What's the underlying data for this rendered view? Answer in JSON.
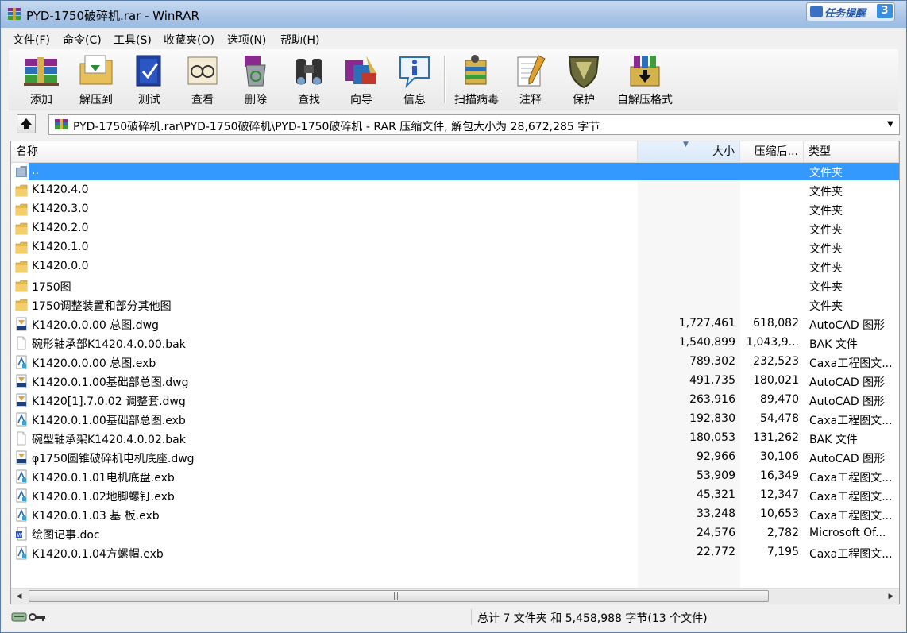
{
  "window": {
    "title": "PYD-1750破碎机.rar - WinRAR",
    "task_widget": {
      "label": "任务提醒",
      "count": "3"
    }
  },
  "menu": [
    "文件(F)",
    "命令(C)",
    "工具(S)",
    "收藏夹(O)",
    "选项(N)",
    "帮助(H)"
  ],
  "toolbar": [
    {
      "label": "添加",
      "icon": "add-books-icon"
    },
    {
      "label": "解压到",
      "icon": "extract-folder-icon"
    },
    {
      "label": "测试",
      "icon": "test-book-icon"
    },
    {
      "label": "查看",
      "icon": "view-glasses-icon"
    },
    {
      "label": "删除",
      "icon": "delete-recycle-icon"
    },
    {
      "label": "查找",
      "icon": "find-binoculars-icon"
    },
    {
      "label": "向导",
      "icon": "wizard-icon"
    },
    {
      "label": "信息",
      "icon": "info-icon"
    },
    {
      "label": "扫描病毒",
      "icon": "scan-virus-icon"
    },
    {
      "label": "注释",
      "icon": "comment-notepad-icon"
    },
    {
      "label": "保护",
      "icon": "protect-shield-icon"
    },
    {
      "label": "自解压格式",
      "icon": "sfx-box-icon"
    }
  ],
  "address": {
    "path": "PYD-1750破碎机.rar\\PYD-1750破碎机\\PYD-1750破碎机 - RAR 压缩文件, 解包大小为 28,672,285 字节"
  },
  "columns": {
    "name": "名称",
    "size": "大小",
    "packed": "压缩后...",
    "type": "类型"
  },
  "files": [
    {
      "name": "..",
      "size": "",
      "packed": "",
      "type": "文件夹",
      "icon": "folder-up-icon",
      "selected": true
    },
    {
      "name": "K1420.4.0",
      "size": "",
      "packed": "",
      "type": "文件夹",
      "icon": "folder-icon"
    },
    {
      "name": "K1420.3.0",
      "size": "",
      "packed": "",
      "type": "文件夹",
      "icon": "folder-icon"
    },
    {
      "name": "K1420.2.0",
      "size": "",
      "packed": "",
      "type": "文件夹",
      "icon": "folder-icon"
    },
    {
      "name": "K1420.1.0",
      "size": "",
      "packed": "",
      "type": "文件夹",
      "icon": "folder-icon"
    },
    {
      "name": "K1420.0.0",
      "size": "",
      "packed": "",
      "type": "文件夹",
      "icon": "folder-icon"
    },
    {
      "name": "1750图",
      "size": "",
      "packed": "",
      "type": "文件夹",
      "icon": "folder-icon"
    },
    {
      "name": "1750调整装置和部分其他图",
      "size": "",
      "packed": "",
      "type": "文件夹",
      "icon": "folder-icon"
    },
    {
      "name": "K1420.0.0.00 总图.dwg",
      "size": "1,727,461",
      "packed": "618,082",
      "type": "AutoCAD 图形",
      "icon": "dwg-file-icon"
    },
    {
      "name": "碗形轴承部K1420.4.0.00.bak",
      "size": "1,540,899",
      "packed": "1,043,9...",
      "type": "BAK 文件",
      "icon": "blank-file-icon"
    },
    {
      "name": "K1420.0.0.00 总图.exb",
      "size": "789,302",
      "packed": "232,523",
      "type": "Caxa工程图文...",
      "icon": "exb-file-icon"
    },
    {
      "name": "K1420.0.1.00基础部总图.dwg",
      "size": "491,735",
      "packed": "180,021",
      "type": "AutoCAD 图形",
      "icon": "dwg-file-icon"
    },
    {
      "name": "K1420[1].7.0.02 调整套.dwg",
      "size": "263,916",
      "packed": "89,470",
      "type": "AutoCAD 图形",
      "icon": "dwg-file-icon"
    },
    {
      "name": "K1420.0.1.00基础部总图.exb",
      "size": "192,830",
      "packed": "54,478",
      "type": "Caxa工程图文...",
      "icon": "exb-file-icon"
    },
    {
      "name": "碗型轴承架K1420.4.0.02.bak",
      "size": "180,053",
      "packed": "131,262",
      "type": "BAK 文件",
      "icon": "blank-file-icon"
    },
    {
      "name": "φ1750圆锥破碎机电机底座.dwg",
      "size": "92,966",
      "packed": "30,106",
      "type": "AutoCAD 图形",
      "icon": "dwg-file-icon"
    },
    {
      "name": "K1420.0.1.01电机底盘.exb",
      "size": "53,909",
      "packed": "16,349",
      "type": "Caxa工程图文...",
      "icon": "exb-file-icon"
    },
    {
      "name": "K1420.0.1.02地脚螺钉.exb",
      "size": "45,321",
      "packed": "12,347",
      "type": "Caxa工程图文...",
      "icon": "exb-file-icon"
    },
    {
      "name": "K1420.0.1.03 基 板.exb",
      "size": "33,248",
      "packed": "10,653",
      "type": "Caxa工程图文...",
      "icon": "exb-file-icon"
    },
    {
      "name": "绘图记事.doc",
      "size": "24,576",
      "packed": "2,782",
      "type": "Microsoft Of...",
      "icon": "doc-file-icon"
    },
    {
      "name": "K1420.0.1.04方螺帽.exb",
      "size": "22,772",
      "packed": "7,195",
      "type": "Caxa工程图文...",
      "icon": "exb-file-icon"
    }
  ],
  "status": {
    "summary": "总计 7 文件夹 和 5,458,988 字节(13 个文件)"
  }
}
